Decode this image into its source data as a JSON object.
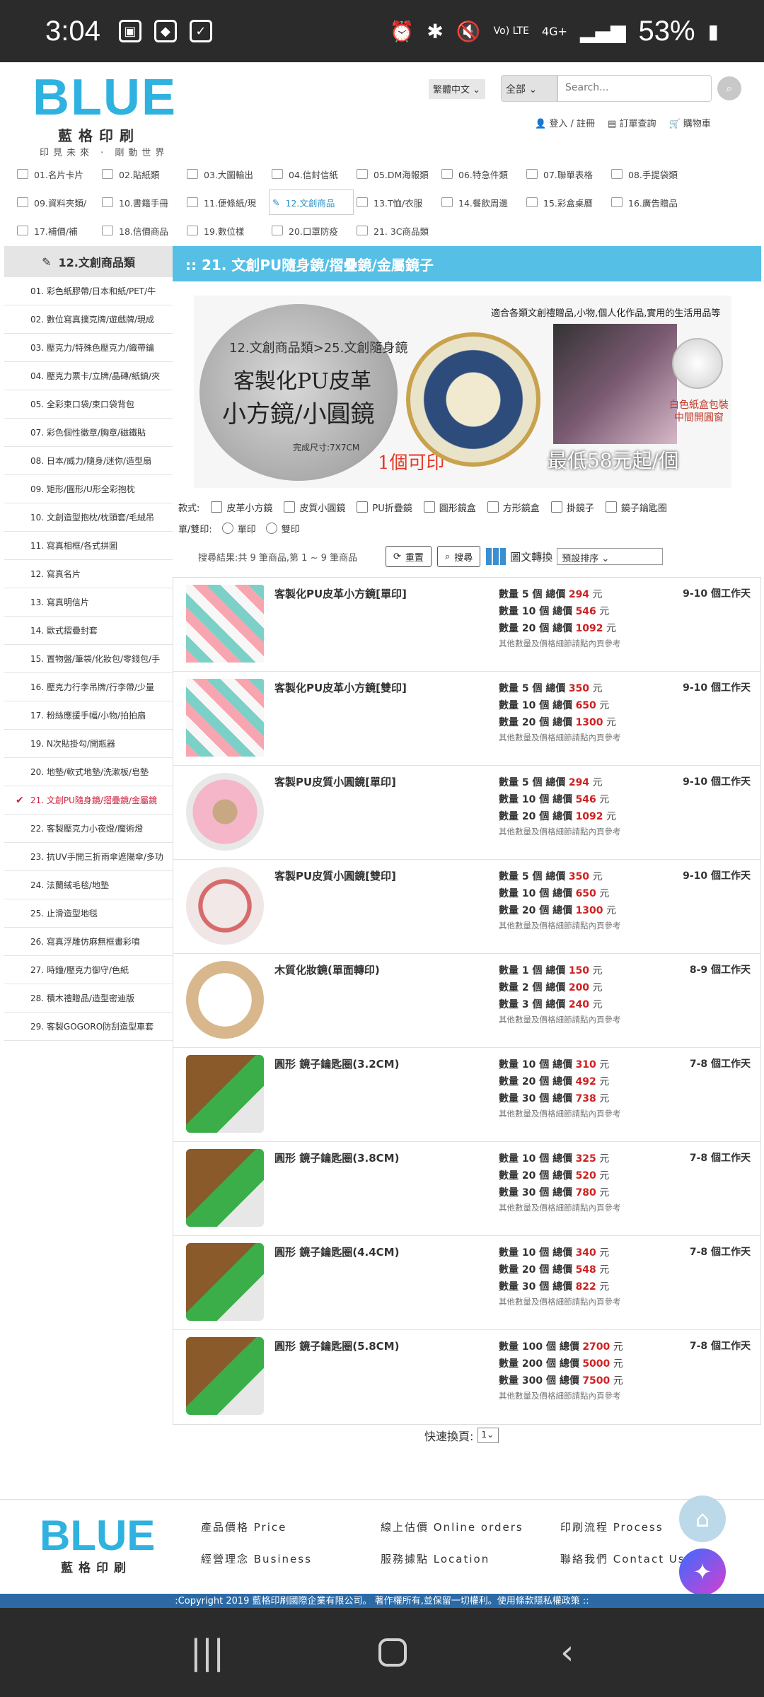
{
  "status": {
    "time": "3:04",
    "battery": "53%",
    "network": "4G+",
    "volte": "Vo) LTE"
  },
  "header": {
    "logo_word": "BLUE",
    "logo_cn": "藍格印刷",
    "slogan": "印見未來 · 剛動世界",
    "lang": "繁體中文",
    "category": "全部",
    "search_placeholder": "Search...",
    "links": [
      "登入",
      "註冊",
      "訂單查詢",
      "購物車"
    ]
  },
  "categories": [
    [
      "01.名片卡片",
      "02.貼紙類",
      "03.大圖輸出",
      "04.信封信紙",
      "05.DM海報類",
      "06.特急件類",
      "07.聯單表格",
      "08.手提袋類"
    ],
    [
      "09.資料夾類/",
      "10.書籍手冊",
      "11.便條紙/現",
      "12.文創商品",
      "13.T恤/衣服",
      "14.餐飲周邊",
      "15.彩盒桌曆",
      "16.廣告贈品"
    ],
    [
      "17.補價/補",
      "18.信價商品",
      "19.數位樣",
      "20.口罩防疫",
      "21. 3C商品類"
    ]
  ],
  "sidebar": {
    "title": "12.文創商品類",
    "items": [
      "01. 彩色紙膠帶/日本和紙/PET/牛",
      "02. 數位寫真撲克牌/遊戲牌/現成",
      "03. 壓克力/特殊色壓克力/織帶鑰",
      "04. 壓克力票卡/立牌/晶磚/紙鎮/夾",
      "05. 全彩束口袋/束口袋背包",
      "07. 彩色個性徽章/胸章/磁鐵貼",
      "08. 日本/威力/隨身/迷你/造型扇",
      "09. 矩形/圓形/U形全彩抱枕",
      "10. 文創造型抱枕/枕頭套/毛絨吊",
      "11. 寫真相框/各式拼圖",
      "12. 寫真名片",
      "13. 寫真明信片",
      "14. 歐式摺疊封套",
      "15. 置物盤/筆袋/化妝包/零錢包/手",
      "16. 壓克力行李吊牌/行李帶/少量",
      "17. 粉絲應援手幅/小物/拍拍扇",
      "19. N次貼掛勾/開瓶器",
      "20. 地墊/軟式地墊/洗漱板/皂墊",
      "21. 文創PU隨身鏡/摺疊鏡/金屬鏡",
      "22. 客製壓克力小夜燈/魔術燈",
      "23. 抗UV手開三折雨傘遮陽傘/多功",
      "24. 法蘭絨毛毯/地墊",
      "25. 止滑造型地毯",
      "26. 寫真浮雕仿麻無框畫彩噴",
      "27. 時鐘/壓克力御守/色紙",
      "28. 積木禮贈品/造型密迪版",
      "29. 客製GOGORO防刮造型車套"
    ],
    "active_index": 18
  },
  "main": {
    "title": ":: 21. 文創PU隨身鏡/摺疊鏡/金屬鏡子",
    "banner": {
      "top": "適合各類文創禮贈品,小物,個人化作品,實用的生活用品等",
      "sub": "12.文創商品類>25.文創隨身鏡",
      "line1": "客製化PU皮革",
      "line2": "小方鏡/小圓鏡",
      "size": "完成尺寸:7X7CM",
      "print": "1個可印",
      "gift": "白色紙盒包裝\n中間開圓窗",
      "price": "最低58元起/個"
    },
    "filters": {
      "style_label": "款式:",
      "styles": [
        "皮革小方鏡",
        "皮質小圓鏡",
        "PU折疊鏡",
        "圓形鏡盒",
        "方形鏡盒",
        "掛鏡子",
        "鏡子鑰匙圈"
      ],
      "side_label": "單/雙印:",
      "sides": [
        "單印",
        "雙印"
      ]
    },
    "result_text": "搜尋結果:共 9 筆商品,第 1 ~ 9 筆商品",
    "reset_label": "重置",
    "search_label": "搜尋",
    "view_label": "圖文轉換",
    "sort_label": "預設排序"
  },
  "products": [
    {
      "name": "客製化PU皮革小方鏡[單印]",
      "img": "pat",
      "days": "9-10 個工作天",
      "prices": [
        [
          "數量 5 個 總價",
          "294"
        ],
        [
          "數量 10 個 總價",
          "546"
        ],
        [
          "數量 20 個 總價",
          "1092"
        ]
      ]
    },
    {
      "name": "客製化PU皮革小方鏡[雙印]",
      "img": "pat",
      "days": "9-10 個工作天",
      "prices": [
        [
          "數量 5 個 總價",
          "350"
        ],
        [
          "數量 10 個 總價",
          "650"
        ],
        [
          "數量 20 個 總價",
          "1300"
        ]
      ]
    },
    {
      "name": "客製PU皮質小圓鏡[單印]",
      "img": "donut",
      "days": "9-10 個工作天",
      "prices": [
        [
          "數量 5 個 總價",
          "294"
        ],
        [
          "數量 10 個 總價",
          "546"
        ],
        [
          "數量 20 個 總價",
          "1092"
        ]
      ]
    },
    {
      "name": "客製PU皮質小圓鏡[雙印]",
      "img": "flower",
      "days": "9-10 個工作天",
      "prices": [
        [
          "數量 5 個 總價",
          "350"
        ],
        [
          "數量 10 個 總價",
          "650"
        ],
        [
          "數量 20 個 總價",
          "1300"
        ]
      ]
    },
    {
      "name": "木質化妝鏡(單面轉印)",
      "img": "wood",
      "days": "8-9 個工作天",
      "prices": [
        [
          "數量 1 個 總價",
          "150"
        ],
        [
          "數量 2 個 總價",
          "200"
        ],
        [
          "數量 3 個 總價",
          "240"
        ]
      ]
    },
    {
      "name": "圓形 鏡子鑰匙圈(3.2CM)",
      "img": "keys",
      "days": "7-8 個工作天",
      "prices": [
        [
          "數量 10 個 總價",
          "310"
        ],
        [
          "數量 20 個 總價",
          "492"
        ],
        [
          "數量 30 個 總價",
          "738"
        ]
      ]
    },
    {
      "name": "圓形 鏡子鑰匙圈(3.8CM)",
      "img": "keys",
      "days": "7-8 個工作天",
      "prices": [
        [
          "數量 10 個 總價",
          "325"
        ],
        [
          "數量 20 個 總價",
          "520"
        ],
        [
          "數量 30 個 總價",
          "780"
        ]
      ]
    },
    {
      "name": "圓形 鏡子鑰匙圈(4.4CM)",
      "img": "keys",
      "days": "7-8 個工作天",
      "prices": [
        [
          "數量 10 個 總價",
          "340"
        ],
        [
          "數量 20 個 總價",
          "548"
        ],
        [
          "數量 30 個 總價",
          "822"
        ]
      ]
    },
    {
      "name": "圓形 鏡子鑰匙圈(5.8CM)",
      "img": "keys",
      "days": "7-8 個工作天",
      "prices": [
        [
          "數量 100 個 總價",
          "2700"
        ],
        [
          "數量 200 個 總價",
          "5000"
        ],
        [
          "數量 300 個 總價",
          "7500"
        ]
      ]
    }
  ],
  "price_unit": "元",
  "price_note": "其他數量及價格細節請點內頁參考",
  "pager": {
    "label": "快速換頁:",
    "value": "1"
  },
  "footer": {
    "logo_word": "BLUE",
    "logo_cn": "藍格印刷",
    "links": [
      "產品價格 Price",
      "線上估價 Online orders",
      "印刷流程 Process",
      "經營理念 Business",
      "服務據點 Location",
      "聯絡我們 Contact Us"
    ],
    "copyright": ":Copyright 2019 藍格印刷國際企業有限公司。 著作權所有,並保留一切權利。使用條款隱私權政策 ::"
  },
  "colors": {
    "accent": "#56bfe5",
    "logo": "#2fb2df",
    "price": "#cf2020",
    "active": "#d0213d"
  }
}
